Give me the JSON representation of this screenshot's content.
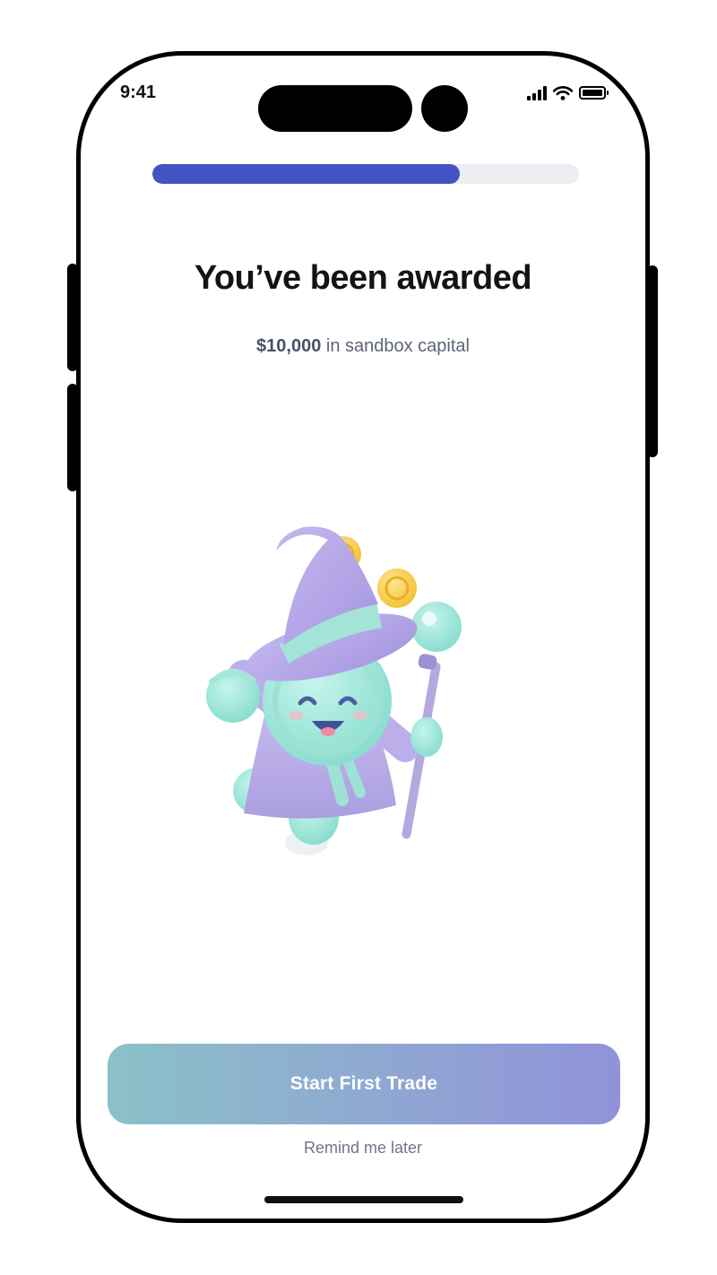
{
  "status_bar": {
    "time": "9:41"
  },
  "onboarding": {
    "progress_fraction": 0.72
  },
  "reward": {
    "title": "You’ve been awarded",
    "amount": "$10,000",
    "amount_suffix": " in sandbox capital"
  },
  "actions": {
    "primary_label": "Start First Trade",
    "secondary_label": "Remind me later"
  },
  "illustration": {
    "name": "wizard-coin-mascot"
  },
  "colors": {
    "progress": "#4452c2",
    "track": "#eceef2",
    "button_start": "#8bc1c8",
    "button_end": "#9192d9"
  }
}
